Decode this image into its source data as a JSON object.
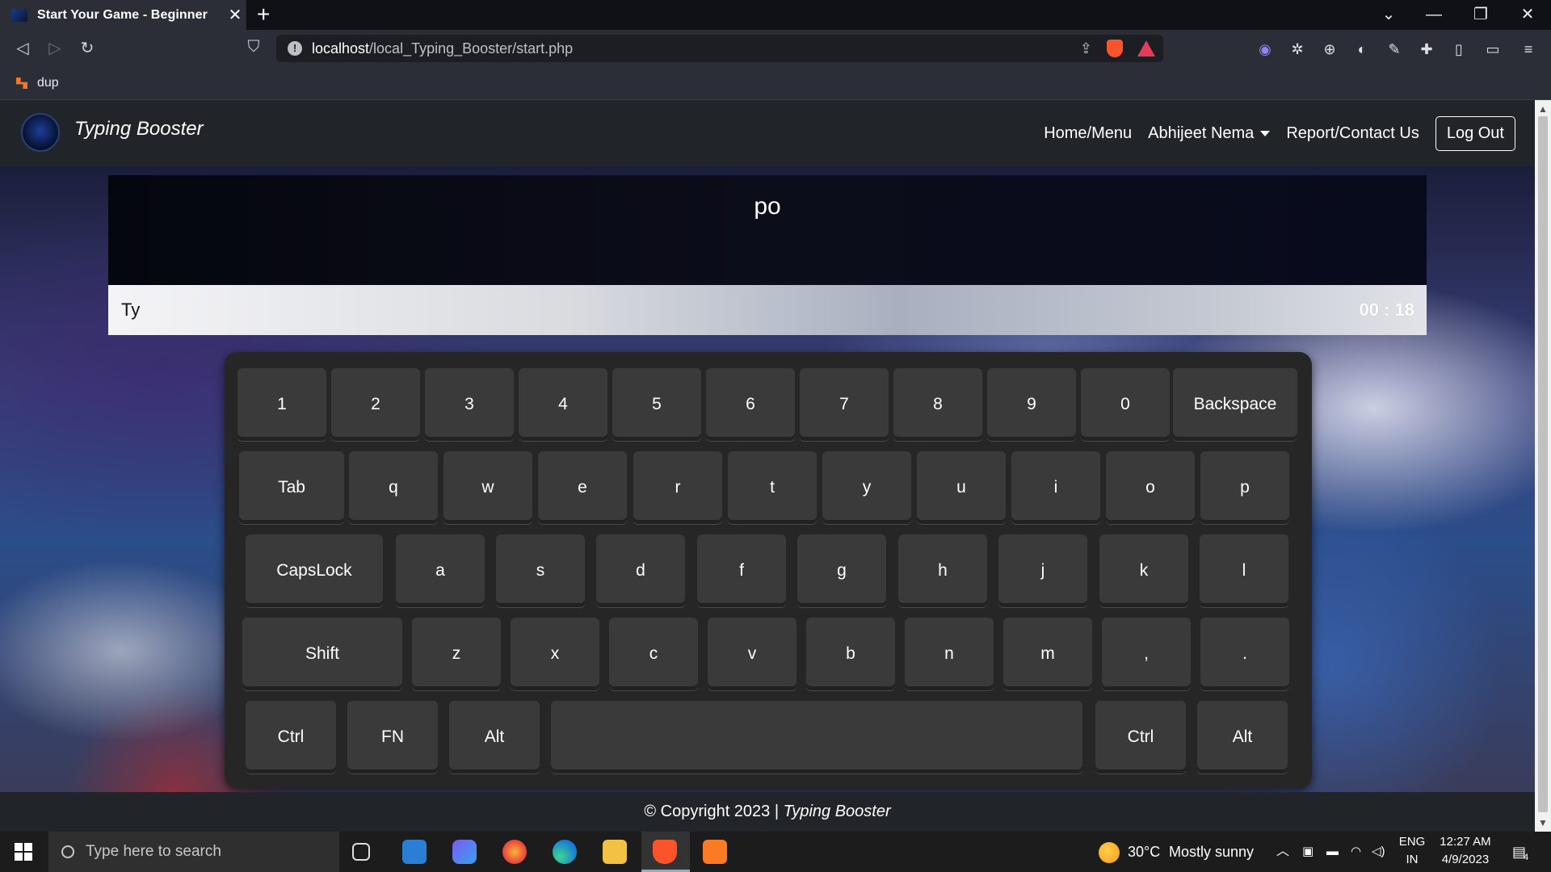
{
  "browser": {
    "tab_title": "Start Your Game - Beginner",
    "tab_close": "✕",
    "new_tab": "+",
    "address_host": "localhost",
    "address_path": "/local_Typing_Booster/start.php",
    "bookmark": "dup",
    "window_controls": [
      "⌄",
      "—",
      "❐",
      "✕"
    ]
  },
  "site": {
    "brand": "Typing Booster",
    "nav": {
      "home": "Home/Menu",
      "user": "Abhijeet Nema",
      "report": "Report/Contact Us",
      "logout": "Log Out"
    }
  },
  "game": {
    "target_word": "po",
    "typed_text": "Ty",
    "timer": "00 : 18"
  },
  "keyboard": {
    "rows": [
      [
        "1",
        "2",
        "3",
        "4",
        "5",
        "6",
        "7",
        "8",
        "9",
        "0",
        "Backspace"
      ],
      [
        "Tab",
        "q",
        "w",
        "e",
        "r",
        "t",
        "y",
        "u",
        "i",
        "o",
        "p"
      ],
      [
        "CapsLock",
        "a",
        "s",
        "d",
        "f",
        "g",
        "h",
        "j",
        "k",
        "l"
      ],
      [
        "Shift",
        "z",
        "x",
        "c",
        "v",
        "b",
        "n",
        "m",
        ",",
        "."
      ],
      [
        "Ctrl",
        "FN",
        "Alt",
        "",
        "Ctrl",
        "Alt"
      ]
    ]
  },
  "footer": {
    "copyright": "© Copyright 2023 | ",
    "brand": "Typing Booster"
  },
  "taskbar": {
    "search_placeholder": "Type here to search",
    "weather_temp": "30°C",
    "weather_desc": "Mostly sunny",
    "lang_1": "ENG",
    "lang_2": "IN",
    "time": "12:27 AM",
    "date": "4/9/2023",
    "notifications": "4"
  }
}
